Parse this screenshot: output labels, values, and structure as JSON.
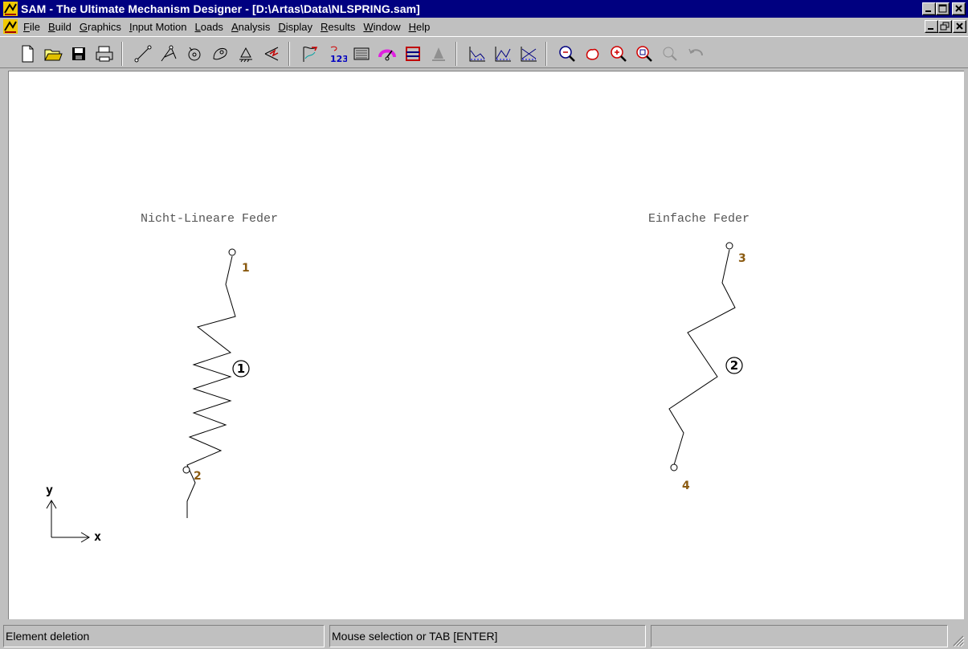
{
  "window": {
    "title": "SAM - The Ultimate Mechanism Designer - [D:\\Artas\\Data\\NLSPRING.sam]",
    "icon": "sam-app-icon"
  },
  "caption_buttons": [
    "minimize",
    "maximize",
    "close"
  ],
  "menu": {
    "items": [
      {
        "label": "File",
        "accel": "F"
      },
      {
        "label": "Build",
        "accel": "B"
      },
      {
        "label": "Graphics",
        "accel": "G"
      },
      {
        "label": "Input Motion",
        "accel": "I"
      },
      {
        "label": "Loads",
        "accel": "L"
      },
      {
        "label": "Analysis",
        "accel": "A"
      },
      {
        "label": "Display",
        "accel": "D"
      },
      {
        "label": "Results",
        "accel": "R"
      },
      {
        "label": "Window",
        "accel": "W"
      },
      {
        "label": "Help",
        "accel": "H"
      }
    ]
  },
  "toolbar": {
    "groups": [
      [
        "new-file-icon",
        "open-folder-icon",
        "save-disk-icon",
        "print-icon"
      ],
      [
        "beam-element-icon",
        "truss-element-icon",
        "gear-element-icon",
        "cam-element-icon",
        "ground-support-icon",
        "spring-element-icon"
      ],
      [
        "input-motion-icon",
        "node-numbering-icon",
        "calculator-icon",
        "gauge-icon",
        "frame-icon",
        "animation-icon"
      ],
      [
        "plot-graph-icon",
        "plot-graph-2-icon",
        "plot-graph-3-icon"
      ],
      [
        "zoom-out-icon",
        "pan-hand-icon",
        "zoom-in-icon",
        "zoom-window-icon",
        "zoom-all-icon",
        "undo-icon"
      ]
    ]
  },
  "canvas": {
    "labels": {
      "left_title": "Nicht-Lineare Feder",
      "right_title": "Einfache Feder"
    },
    "nodes": {
      "n1": "1",
      "n2": "2",
      "n3": "3",
      "n4": "4"
    },
    "elements": {
      "e1": "1",
      "e2": "2"
    },
    "axes": {
      "y": "y",
      "x": "x"
    }
  },
  "status": {
    "pane1": "Element deletion",
    "pane2": "Mouse selection or TAB [ENTER]",
    "pane3": ""
  },
  "colors": {
    "titlebar": "#000080",
    "canvas": "#ffffff",
    "chrome": "#c0c0c0",
    "node_label": "#8a5a10"
  }
}
